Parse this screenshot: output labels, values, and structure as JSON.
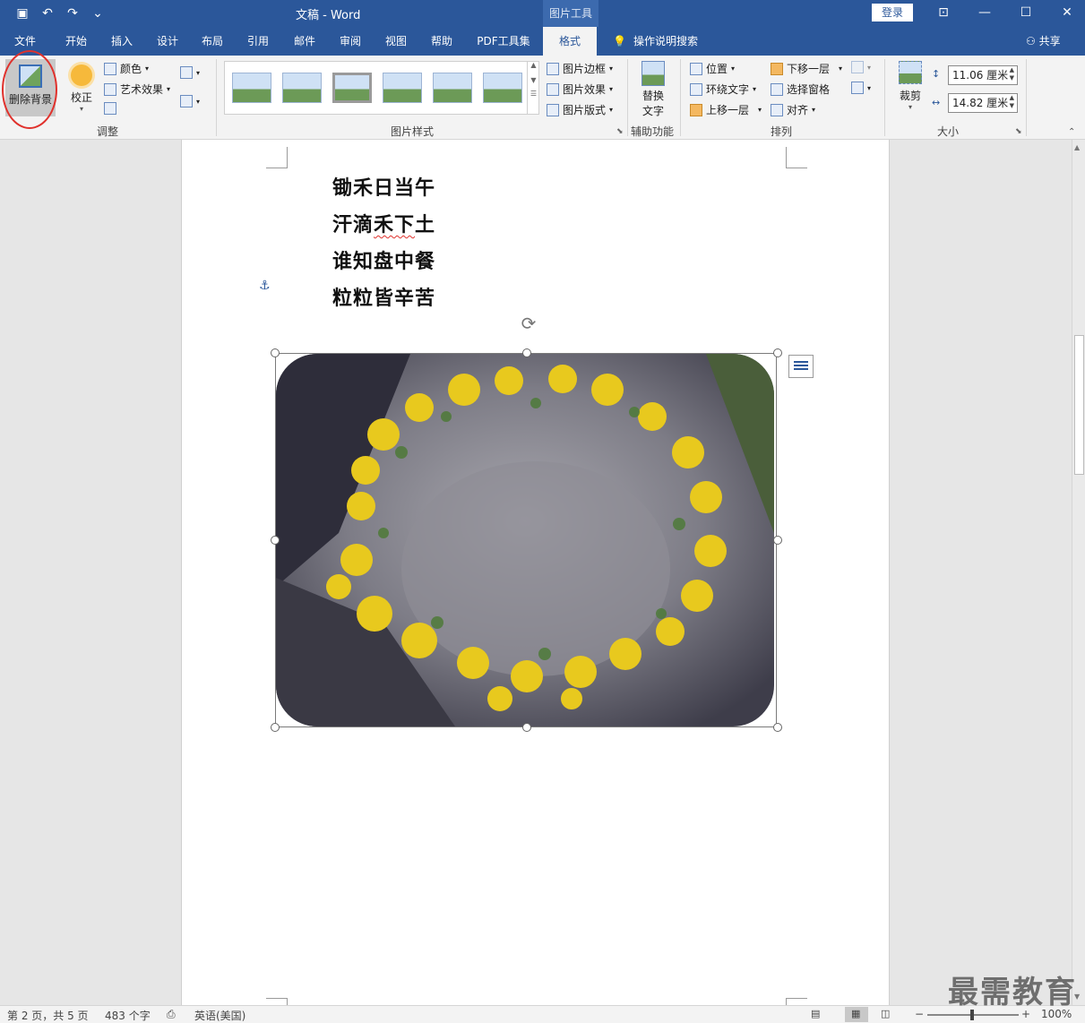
{
  "window": {
    "title": "文稿  -  Word",
    "context_tab": "图片工具",
    "login": "登录"
  },
  "tabs": [
    "文件",
    "开始",
    "插入",
    "设计",
    "布局",
    "引用",
    "邮件",
    "审阅",
    "视图",
    "帮助",
    "PDF工具集",
    "格式"
  ],
  "active_tab": "格式",
  "search": "操作说明搜索",
  "share": "共享",
  "ribbon": {
    "adjust": {
      "label": "调整",
      "remove_bg": "删除背景",
      "correct": "校正",
      "color": "颜色",
      "art_effects": "艺术效果"
    },
    "styles": {
      "label": "图片样式",
      "border": "图片边框",
      "effects": "图片效果",
      "layout": "图片版式"
    },
    "accessibility": {
      "label": "辅助功能",
      "alt_text_line1": "替换",
      "alt_text_line2": "文字"
    },
    "arrange": {
      "label": "排列",
      "position": "位置",
      "wrap": "环绕文字",
      "bring_forward": "上移一层",
      "send_backward": "下移一层",
      "selection_pane": "选择窗格",
      "align": "对齐"
    },
    "size": {
      "label": "大小",
      "crop": "裁剪",
      "height": "11.06 厘米",
      "width": "14.82 厘米"
    }
  },
  "document": {
    "poem": [
      "锄禾日当午",
      "汗滴禾下土",
      "谁知盘中餐",
      "粒粒皆辛苦"
    ],
    "squiggle_word": "禾下"
  },
  "status": {
    "page": "第 2 页，共 5 页",
    "words": "483 个字",
    "language": "英语(美国)",
    "zoom": "100%"
  },
  "watermark": "最需教育",
  "colors": {
    "accent": "#2b579a",
    "ribbon_bg": "#f3f3f3",
    "highlight_circle": "#e0312c"
  }
}
